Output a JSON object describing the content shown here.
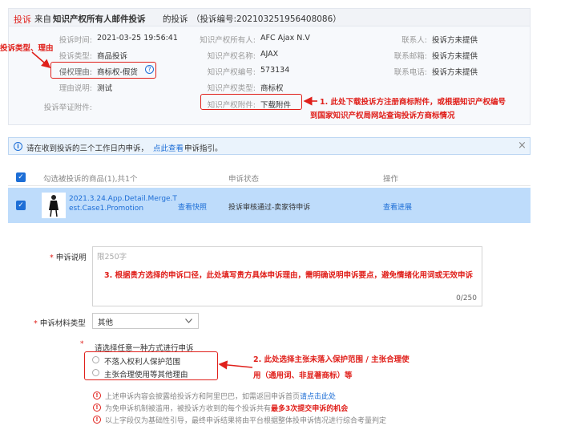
{
  "complaint": {
    "tag": "投诉",
    "from_prefix": "来自",
    "from_party": "知识产权所有人邮件投诉",
    "from_suffix": "的投诉",
    "complaint_no": "（投诉编号:20210325195640808​6）",
    "left_fields": [
      {
        "label": "投诉时间:",
        "value": "2021-03-25 19:56:41"
      },
      {
        "label": "投诉类型:",
        "value": "商品投诉"
      },
      {
        "label": "侵权理由:",
        "value": "商标权-假货"
      },
      {
        "label": "理由说明:",
        "value": "测试"
      },
      {
        "label": "投诉举证附件:",
        "value": ""
      }
    ],
    "mid_fields": [
      {
        "label": "知识产权所有人:",
        "value": "AFC Ajax N.V"
      },
      {
        "label": "知识产权名称:",
        "value": "AJAX"
      },
      {
        "label": "知识产权编号:",
        "value": "573134"
      },
      {
        "label": "知识产权类型:",
        "value": "商标权"
      },
      {
        "label": "知识产权附件:",
        "value": "下载附件"
      }
    ],
    "right_fields": [
      {
        "label": "联系人:",
        "value": "投诉方未提供"
      },
      {
        "label": "联系邮箱:",
        "value": "投诉方未提供"
      },
      {
        "label": "联系电话:",
        "value": "投诉方未提供"
      }
    ]
  },
  "annotations": {
    "type_reason": "投诉类型、理由",
    "note1_line1": "1. 此处下载投诉方注册商标附件，或根据知识产权编号",
    "note1_line2": "到国家知识产权局网站查询投诉方商标情况",
    "note2_line1": "2. 此处选择主张未落入保护范围 / 主张合理使",
    "note2_line2": "用（通用词、非显著商标）等",
    "note3": "3. 根据贵方选择的申诉口径，此处填写贵方具体申诉理由，需明确说明申诉要点，避免情绪化用词或无效申诉"
  },
  "notice": {
    "text": "请在收到投诉的三个工作日内申诉，",
    "link": "点此查看",
    "suffix": "申诉指引。",
    "close": "×"
  },
  "table": {
    "headers": [
      "勾选被投诉的商品(1),共1个",
      "申诉状态",
      "操作"
    ],
    "row": {
      "product_name": "2021.3.24.App.Detail.Merge.Test.Case1.Promotion",
      "snapshot": "查看快照",
      "status": "投诉审核通过-卖家待申诉",
      "action": "查看进展"
    }
  },
  "form": {
    "reason_label": "申诉说明",
    "reason_placeholder": "限250字",
    "reason_counter": "0/250",
    "material_label": "申诉材料类型",
    "material_value": "其他",
    "method_label": "请选择任意一种方式进行申诉",
    "options": [
      "不落入权利人保护范围",
      "主张合理使用等其他理由"
    ],
    "tips": [
      {
        "text": "上述申诉内容会披露给投诉方和阿里巴巴，如需返回申诉首页",
        "link": "请点击此处"
      },
      {
        "text": "为免申诉机制被滥用，被投诉方收到的每个投诉共有",
        "link": "最多3次提交申诉的机会"
      },
      {
        "text": "以上字段仅为基础性引导，最终申诉结果将由平台根据整体投申诉情况进行综合考量判定",
        "link": ""
      }
    ]
  },
  "colors": {
    "accent": "#1d6ed6",
    "alert": "#e0201b",
    "row_selected": "#bedcfb"
  }
}
